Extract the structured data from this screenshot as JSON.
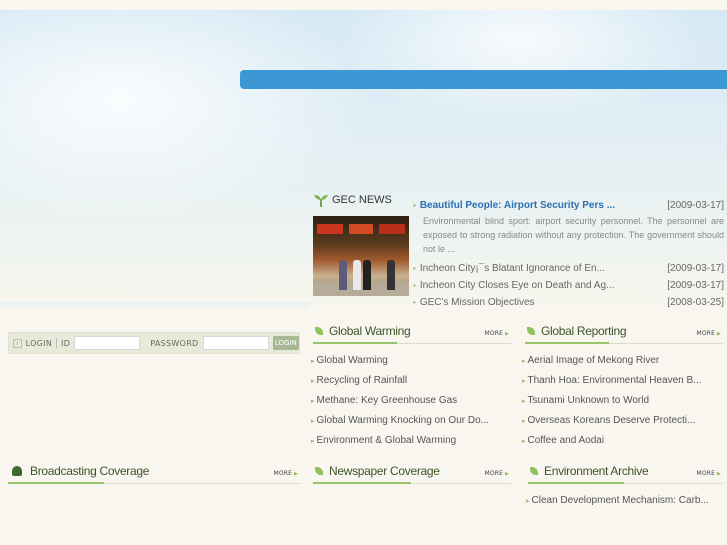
{
  "login": {
    "login_label": "LOGIN",
    "id_label": "ID",
    "password_label": "PASSWORD",
    "button_label": "LOGIN"
  },
  "news": {
    "title": "GEC NEWS",
    "items": [
      {
        "title": "Beautiful People: Airport Security Pers ...",
        "date": "[2009-03-17]"
      },
      {
        "title": "Incheon City¡¯s Blatant Ignorance of En...",
        "date": "[2009-03-17]"
      },
      {
        "title": "Incheon City Closes Eye on Death and Ag...",
        "date": "[2009-03-17]"
      },
      {
        "title": "GEC's Mission Objectives",
        "date": "[2008-03-25]"
      }
    ],
    "summary": "Environmental blind sport: airport security personnel. The personnel are exposed to strong radiation without any protection. The government should not le ..."
  },
  "more_label": "MORE",
  "global_warming": {
    "title": "Global Warming",
    "items": [
      "Global Warming",
      "Recycling of Rainfall",
      "Methane: Key Greenhouse Gas",
      "Global Warming Knocking on Our Do...",
      "Environment & Global Warming"
    ]
  },
  "global_reporting": {
    "title": "Global Reporting",
    "items": [
      "Aerial Image of Mekong River",
      "Thanh Hoa: Environmental Heaven B...",
      "Tsunami Unknown to World",
      "Overseas Koreans Deserve Protecti...",
      "Coffee and Aodai"
    ]
  },
  "broadcasting": {
    "title": "Broadcasting Coverage"
  },
  "newspaper": {
    "title": "Newspaper Coverage"
  },
  "archive": {
    "title": "Environment Archive",
    "items": [
      "Clean Development Mechanism: Carb..."
    ]
  }
}
